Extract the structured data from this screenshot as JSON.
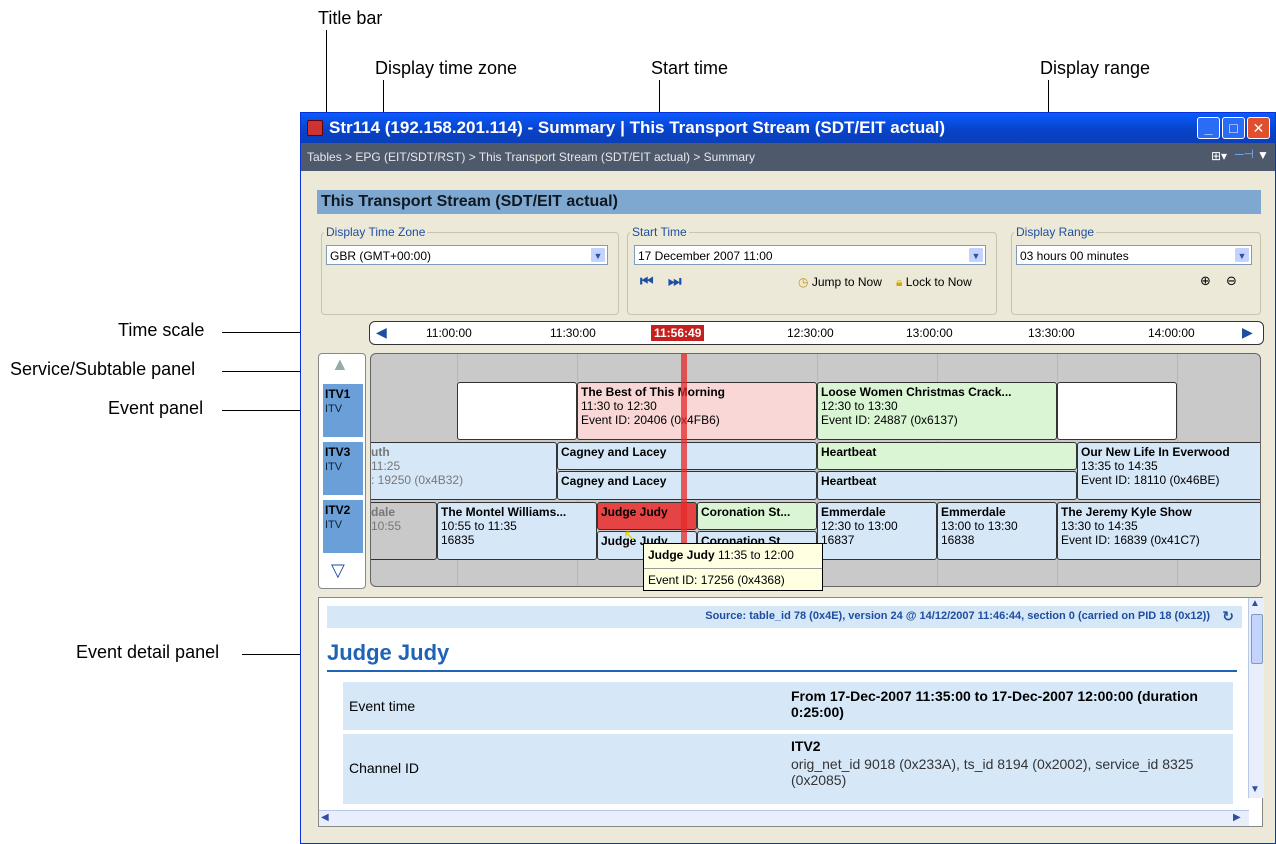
{
  "callouts": {
    "title_bar": "Title bar",
    "display_time_zone": "Display time zone",
    "start_time": "Start time",
    "display_range": "Display range",
    "time_scale": "Time scale",
    "service_subtable_panel": "Service/Subtable panel",
    "event_panel": "Event panel",
    "event_detail_panel": "Event detail panel"
  },
  "window": {
    "title": "Str114 (192.158.201.114) - Summary | This Transport Stream (SDT/EIT actual)",
    "breadcrumb": "Tables > EPG (EIT/SDT/RST) > This Transport Stream (SDT/EIT actual) > Summary",
    "header": "This Transport Stream (SDT/EIT actual)"
  },
  "controls": {
    "time_zone": {
      "legend": "Display Time Zone",
      "value": "GBR (GMT+00:00)"
    },
    "start_time": {
      "legend": "Start Time",
      "value": "17 December 2007 11:00",
      "jump": "Jump to Now",
      "lock": "Lock to Now"
    },
    "range": {
      "legend": "Display Range",
      "value": "03 hours 00 minutes"
    }
  },
  "timescale": {
    "ticks": [
      "11:00:00",
      "11:30:00",
      "12:30:00",
      "13:00:00",
      "13:30:00",
      "14:00:00"
    ],
    "now": "11:56:49"
  },
  "services": [
    {
      "id": "ITV1",
      "sub": "ITV"
    },
    {
      "id": "ITV3",
      "sub": "ITV"
    },
    {
      "id": "ITV2",
      "sub": "ITV"
    }
  ],
  "events": {
    "best": {
      "name": "The Best of This Morning",
      "time": "11:30 to 12:30",
      "id": "Event ID: 20406 (0x4FB6)"
    },
    "loose": {
      "name": "Loose Women Christmas Crack...",
      "time": "12:30 to 13:30",
      "id": "Event ID: 24887 (0x6137)"
    },
    "uth": {
      "name": "uth",
      "time": "11:25",
      "id": ": 19250 (0x4B32)"
    },
    "cagney1": {
      "name": "Cagney and Lacey"
    },
    "cagney2": {
      "name": "Cagney and Lacey"
    },
    "heart1": {
      "name": "Heartbeat"
    },
    "heart2": {
      "name": "Heartbeat"
    },
    "newlife": {
      "name": "Our New Life In Everwood",
      "time": "13:35 to 14:35",
      "id": "Event ID: 18110 (0x46BE)"
    },
    "dale": {
      "name": "dale",
      "time": "10:55"
    },
    "montel": {
      "name": "The Montel Williams...",
      "time": "10:55 to 11:35",
      "id": "16835"
    },
    "judy1": {
      "name": "Judge Judy"
    },
    "judy2": {
      "name": "Judge Judy"
    },
    "coro1": {
      "name": "Coronation St..."
    },
    "coro2": {
      "name": "Coronation St..."
    },
    "emm1": {
      "name": "Emmerdale",
      "time": "12:30 to 13:00",
      "id": "16837"
    },
    "emm2": {
      "name": "Emmerdale",
      "time": "13:00 to 13:30",
      "id": "16838"
    },
    "kyle": {
      "name": "The Jeremy Kyle Show",
      "time": "13:30 to 14:35",
      "id": "Event ID: 16839 (0x41C7)"
    }
  },
  "tooltip": {
    "name": "Judge Judy",
    "time": "11:35 to 12:00",
    "id": "Event ID: 17256 (0x4368)"
  },
  "detail": {
    "source": "Source: table_id 78 (0x4E), version 24 @ 14/12/2007 11:46:44, section 0 (carried on PID 18 (0x12))",
    "title": "Judge Judy",
    "rows": [
      {
        "key": "Event time",
        "value": "From 17-Dec-2007 11:35:00 to 17-Dec-2007 12:00:00 (duration 0:25:00)"
      },
      {
        "key": "Channel ID",
        "value_title": "ITV2",
        "value": "orig_net_id 9018 (0x233A), ts_id 8194 (0x2002), service_id 8325 (0x2085)"
      }
    ]
  }
}
